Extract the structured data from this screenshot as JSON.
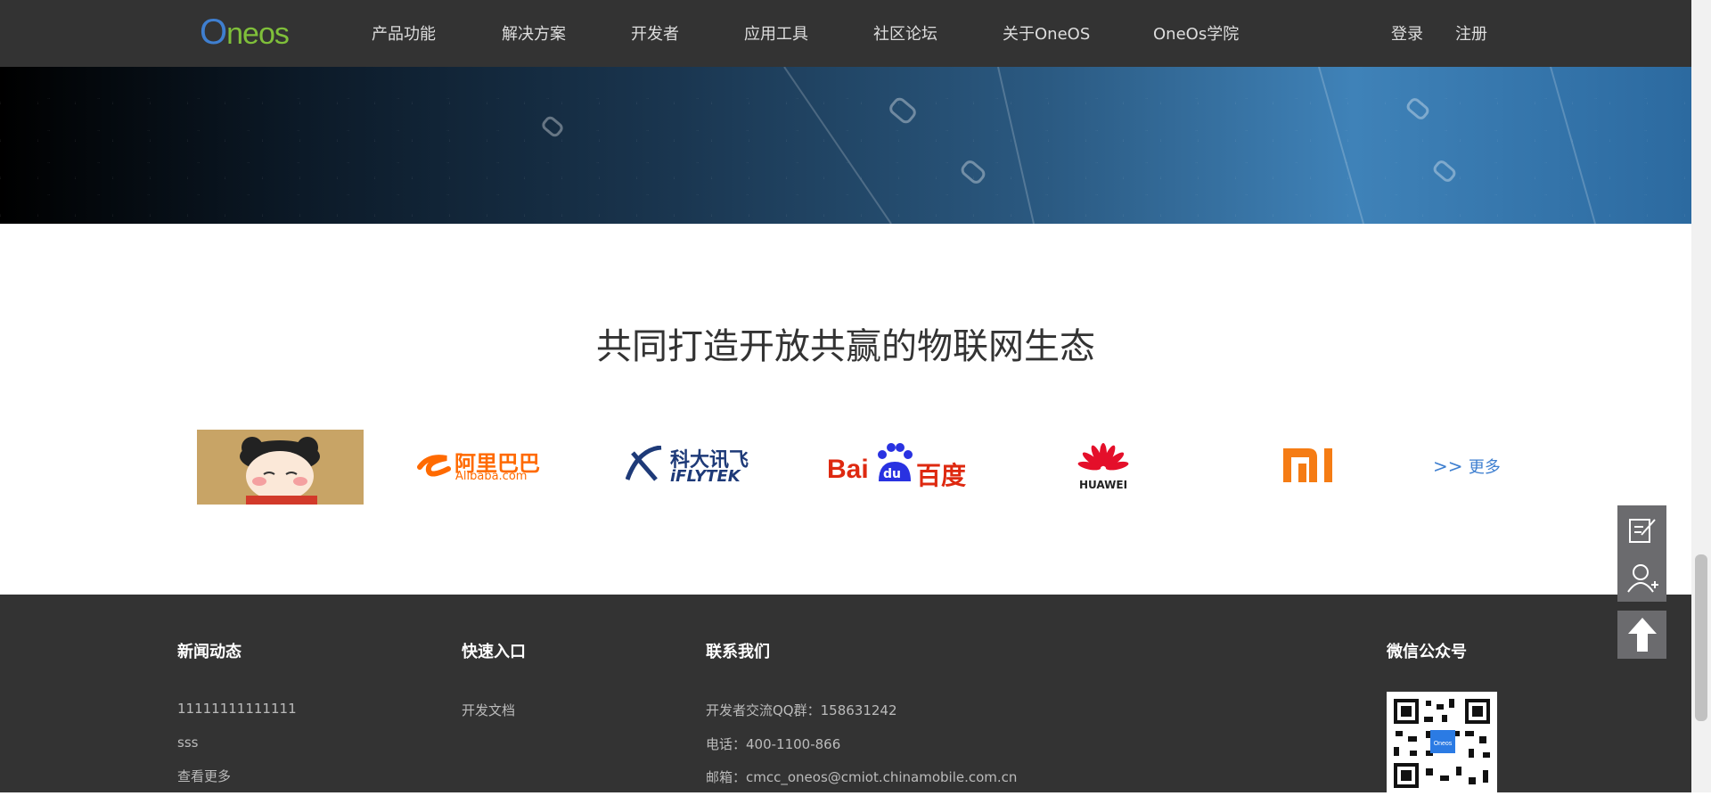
{
  "header": {
    "logo_first": "O",
    "logo_rest": "neos",
    "nav": [
      "产品功能",
      "解决方案",
      "开发者",
      "应用工具",
      "社区论坛",
      "关于OneOS",
      "OneOs学院"
    ],
    "login": "登录",
    "register": "注册"
  },
  "main": {
    "heading": "共同打造开放共赢的物联网生态",
    "partners": {
      "alibaba_cn": "阿里巴巴",
      "alibaba_en": "Alibaba.com",
      "iflytek_cn": "科大讯飞",
      "iflytek_en": "iFLYTEK",
      "baidu_bai": "Bai",
      "baidu_du": "du",
      "baidu_cn": "百度",
      "huawei": "HUAWEI",
      "mi": "mi"
    },
    "more_arrows": ">>",
    "more_text": "更多"
  },
  "footer": {
    "news_title": "新闻动态",
    "news_items": [
      "11111111111111",
      "sss",
      "查看更多"
    ],
    "quick_title": "快速入口",
    "quick_items": [
      "开发文档"
    ],
    "contact_title": "联系我们",
    "contact_items": [
      "开发者交流QQ群：158631242",
      "电话：400-1100-866",
      "邮箱：cmcc_oneos@cmiot.chinamobile.com.cn"
    ],
    "wechat_title": "微信公众号",
    "qr_badge": "Oneos"
  },
  "colors": {
    "header_bg": "#333333",
    "link_blue": "#3e7fd0",
    "alibaba_orange": "#ff6a00",
    "baidu_red": "#de2910",
    "baidu_blue": "#2932e1",
    "mi_orange": "#f57c14"
  }
}
